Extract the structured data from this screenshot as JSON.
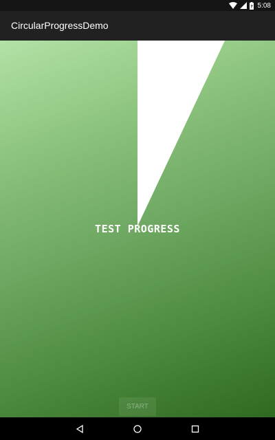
{
  "status_bar": {
    "time": "5:08",
    "battery_percent": 90,
    "icons": [
      "wifi-icon",
      "cell-signal-icon",
      "battery-icon"
    ]
  },
  "app_bar": {
    "title": "CircularProgressDemo"
  },
  "main": {
    "progress_label": "TEST PROGRESS",
    "progress_fraction": 0.07,
    "start_button_label": "START",
    "colors": {
      "gradient_light": "#b3e2a6",
      "gradient_dark": "#2e6a1f",
      "sweep": "#ffffff"
    }
  },
  "nav_bar": {
    "icons": [
      "back-icon",
      "home-icon",
      "recents-icon"
    ]
  }
}
